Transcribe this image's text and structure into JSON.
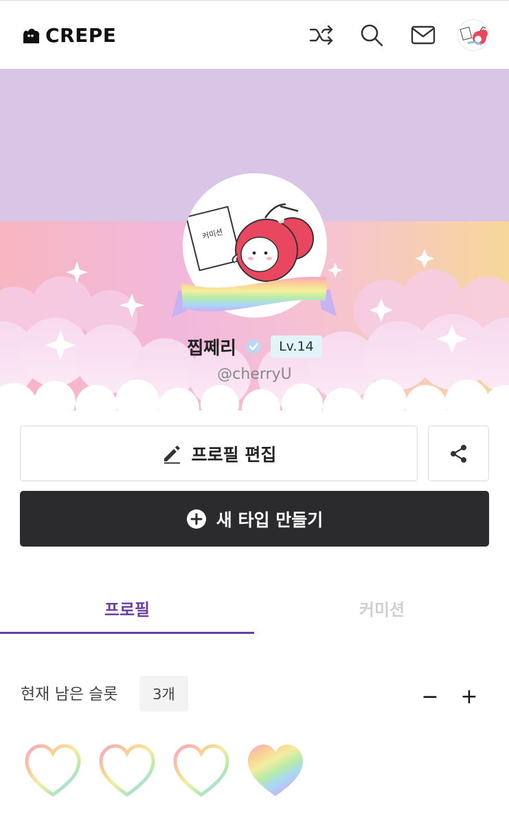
{
  "app": {
    "logo_text": "CREPE"
  },
  "header": {
    "icons": [
      "shuffle-icon",
      "search-icon",
      "mail-icon",
      "avatar"
    ]
  },
  "profile": {
    "name": "찝쩨리",
    "level": "Lv.14",
    "handle": "@cherryU",
    "sign_text": "커미션",
    "accent_color": "#6a3fa0",
    "banner_color": "#d9c6e6"
  },
  "actions": {
    "edit_label": "프로필 편집",
    "new_type_label": "새 타입 만들기"
  },
  "tabs": [
    {
      "label": "프로필",
      "active": true
    },
    {
      "label": "커미션",
      "active": false
    }
  ],
  "slots": {
    "label": "현재 남은 슬롯",
    "count_text": "3개",
    "minus": "−",
    "plus": "+",
    "hearts": [
      {
        "style": "outline"
      },
      {
        "style": "outline"
      },
      {
        "style": "outline"
      },
      {
        "style": "filled"
      }
    ]
  }
}
